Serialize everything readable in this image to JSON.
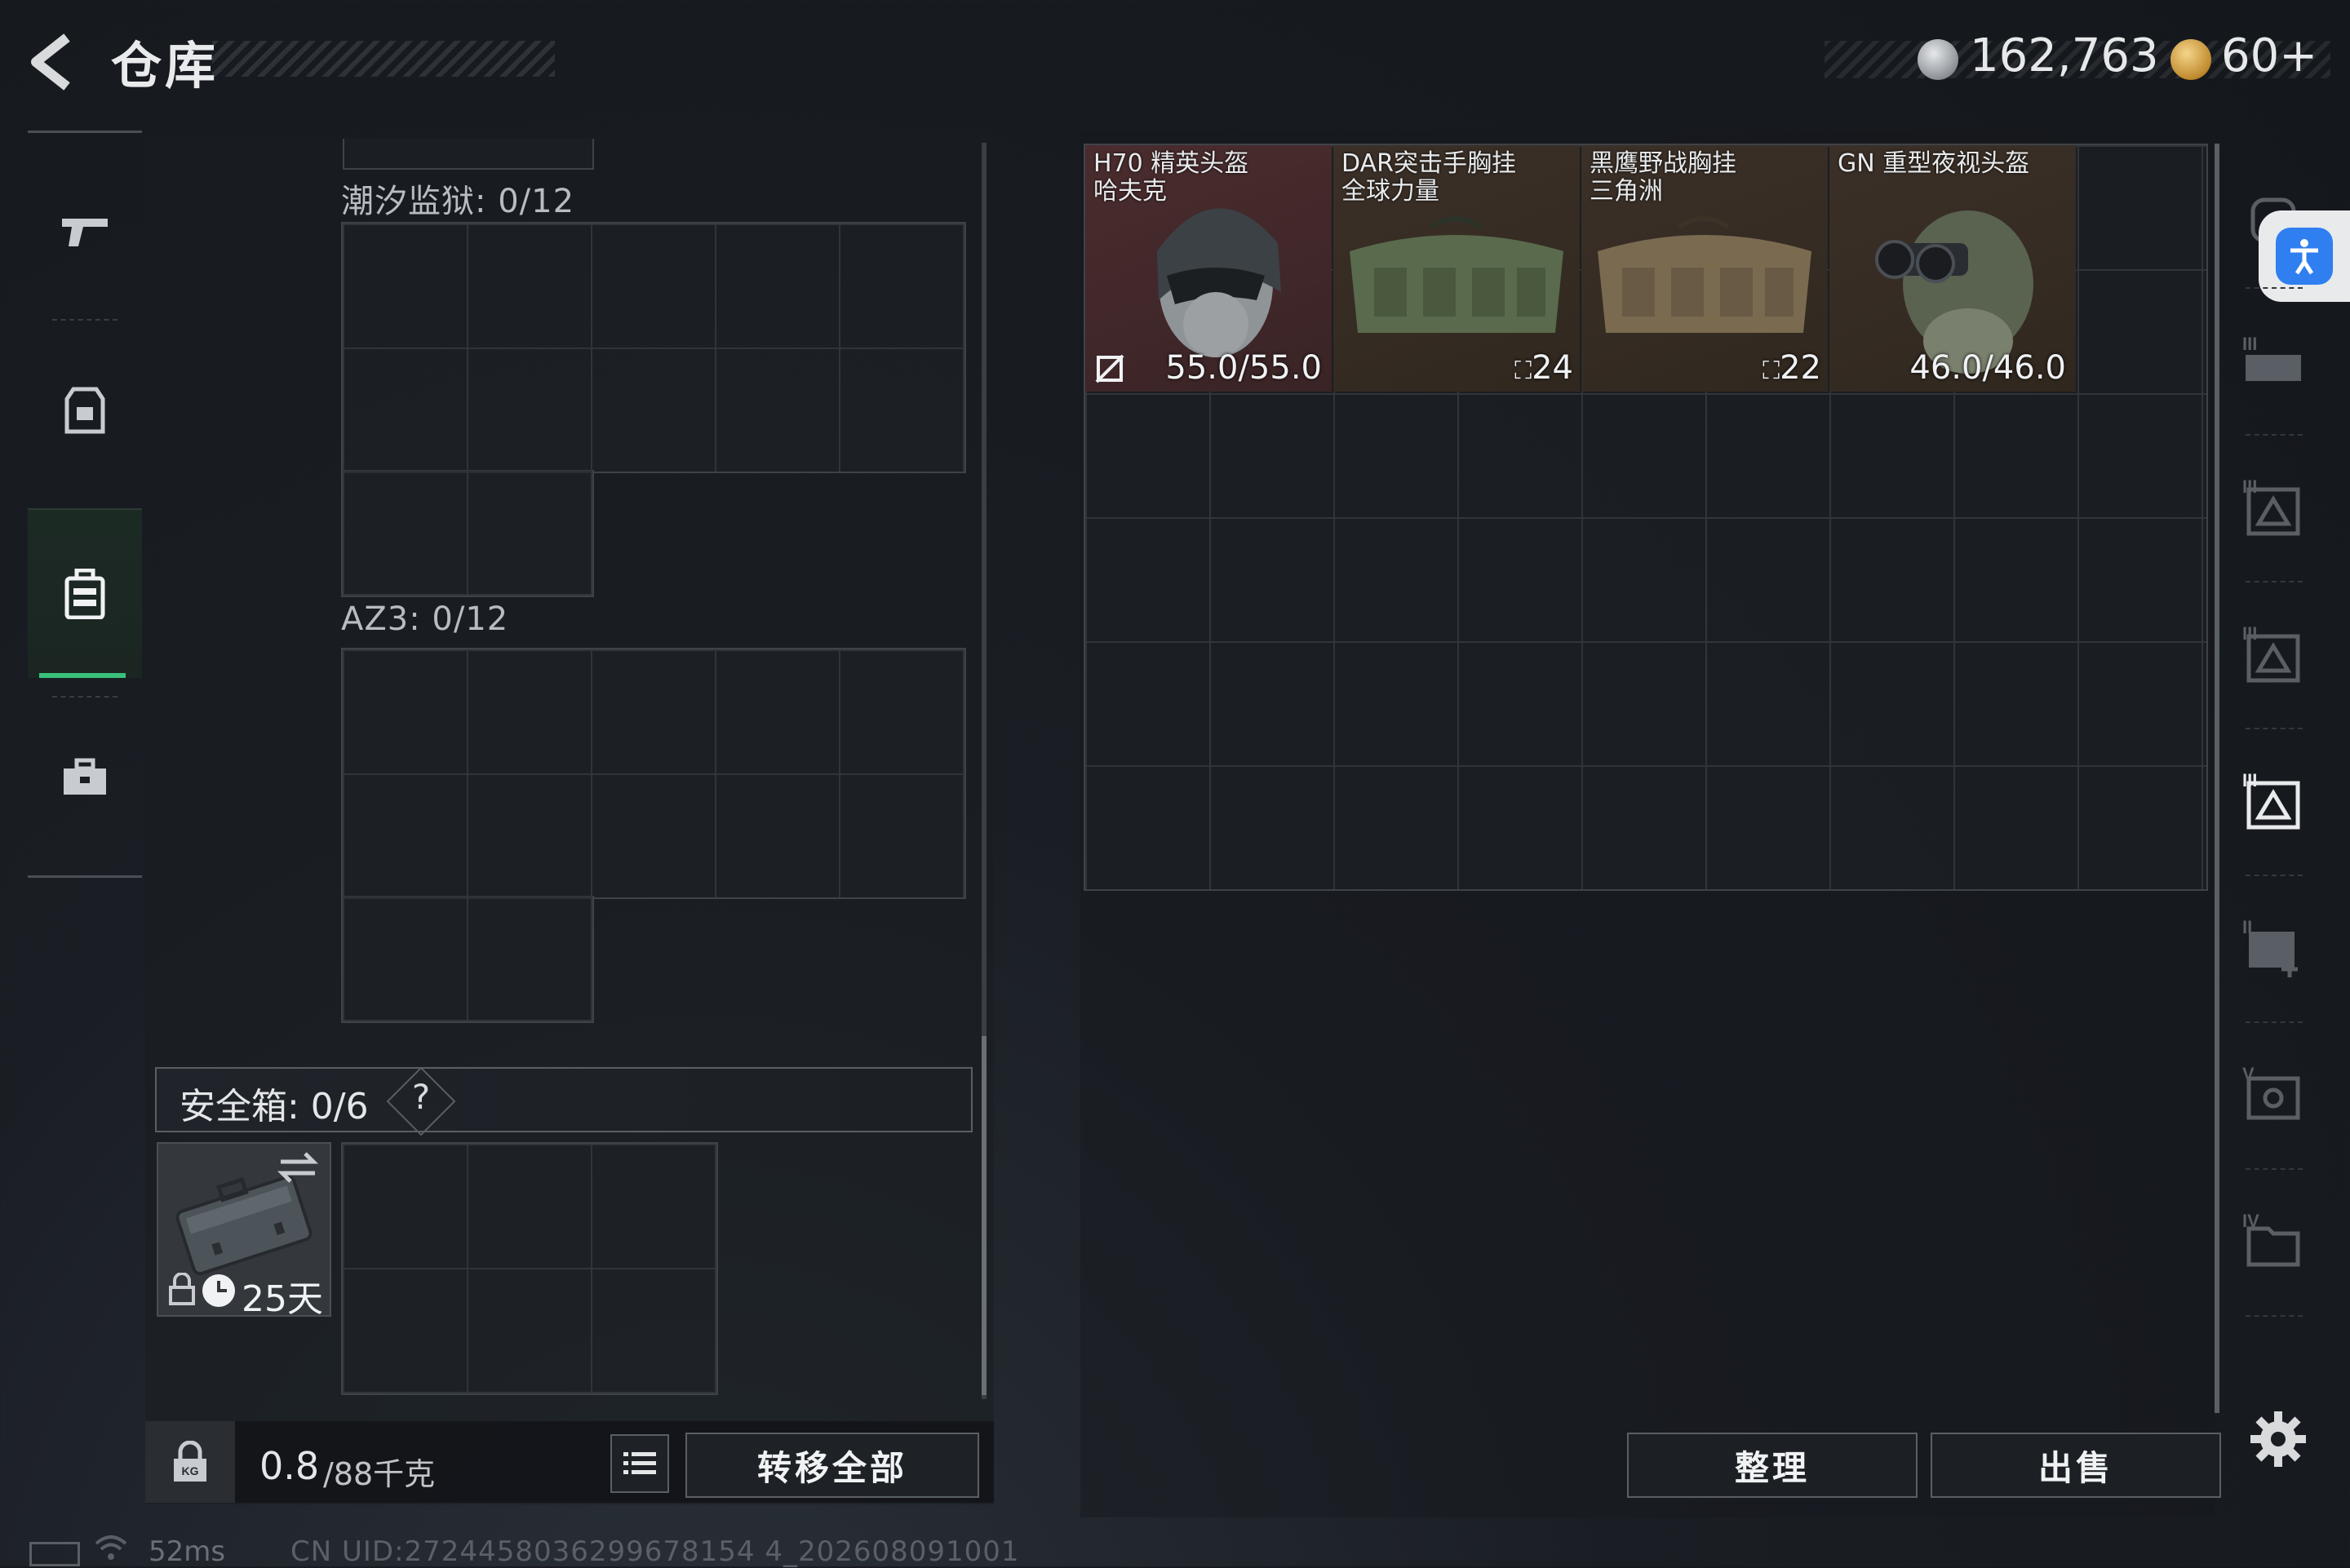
{
  "header": {
    "title": "仓库",
    "currency_silver": "162,763",
    "currency_gold": "60+"
  },
  "left_nav": {
    "items": [
      {
        "name": "weapon",
        "icon": "gun-icon"
      },
      {
        "name": "equipment",
        "icon": "vest-icon"
      },
      {
        "name": "backpack",
        "icon": "backpack-icon",
        "active": true
      },
      {
        "name": "case",
        "icon": "briefcase-icon"
      }
    ]
  },
  "containers": {
    "c1_label": "潮汐监狱: 0/12",
    "c2_label": "AZ3: 0/12"
  },
  "safebox": {
    "label": "安全箱: 0/6",
    "help": "?",
    "days": "25天"
  },
  "bottom_left": {
    "weight_current": "0.8",
    "weight_max": "/88千克",
    "transfer_label": "转移全部"
  },
  "stash_items": [
    {
      "name": "H70 精英头盔\n哈夫克",
      "stat": "55.0/55.0"
    },
    {
      "name": "DAR突击手胸挂\n全球力量",
      "stat": "24"
    },
    {
      "name": "黑鹰野战胸挂\n三角洲",
      "stat": "22"
    },
    {
      "name": "GN 重型夜视头盔",
      "stat": "46.0/46.0"
    }
  ],
  "bottom_right": {
    "sort_label": "整理",
    "sell_label": "出售"
  },
  "status": {
    "ping": "52ms",
    "uid": "CN UID:2724458036299678154 4_202608091001"
  },
  "colors": {
    "accent_green": "#39c07a",
    "accessibility_blue": "#2f7ff0",
    "item_red_bg": "#4a2c2e"
  }
}
